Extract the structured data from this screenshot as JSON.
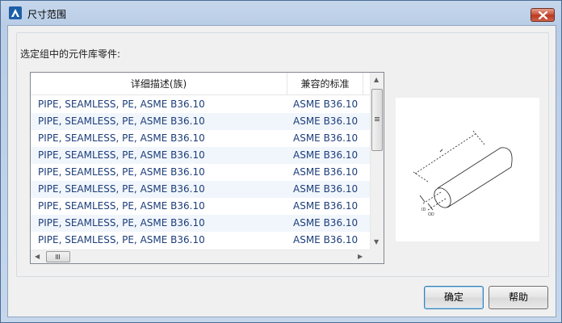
{
  "window": {
    "title": "尺寸范围"
  },
  "group": {
    "label": "选定组中的元件库零件:"
  },
  "list": {
    "columns": [
      "详细描述(族)",
      "兼容的标准"
    ],
    "rows": [
      [
        "PIPE, SEAMLESS, PE, ASME B36.10",
        "ASME B36.10"
      ],
      [
        "PIPE, SEAMLESS, PE, ASME B36.10",
        "ASME B36.10"
      ],
      [
        "PIPE, SEAMLESS, PE, ASME B36.10",
        "ASME B36.10"
      ],
      [
        "PIPE, SEAMLESS, PE, ASME B36.10",
        "ASME B36.10"
      ],
      [
        "PIPE, SEAMLESS, PE, ASME B36.10",
        "ASME B36.10"
      ],
      [
        "PIPE, SEAMLESS, PE, ASME B36.10",
        "ASME B36.10"
      ],
      [
        "PIPE, SEAMLESS, PE, ASME B36.10",
        "ASME B36.10"
      ],
      [
        "PIPE, SEAMLESS, PE, ASME B36.10",
        "ASME B36.10"
      ],
      [
        "PIPE, SEAMLESS, PE, ASME B36.10",
        "ASME B36.10"
      ]
    ]
  },
  "buttons": {
    "ok": "确定",
    "help": "帮助"
  },
  "icons": {
    "app": "autocad-logo-icon",
    "close": "close-icon"
  },
  "colors": {
    "row_text": "#1c3d7a",
    "row_alt": "#f1f6fc",
    "close_red": "#c84b33"
  }
}
